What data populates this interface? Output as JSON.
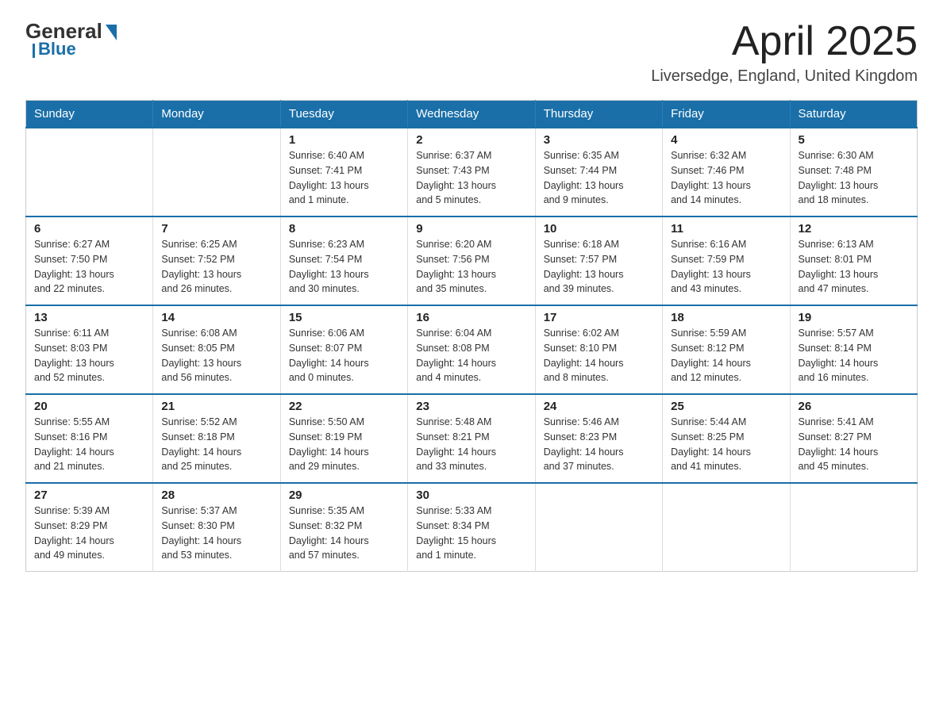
{
  "logo": {
    "general": "General",
    "blue": "Blue"
  },
  "title": "April 2025",
  "subtitle": "Liversedge, England, United Kingdom",
  "days_of_week": [
    "Sunday",
    "Monday",
    "Tuesday",
    "Wednesday",
    "Thursday",
    "Friday",
    "Saturday"
  ],
  "weeks": [
    [
      {
        "day": "",
        "detail": ""
      },
      {
        "day": "",
        "detail": ""
      },
      {
        "day": "1",
        "detail": "Sunrise: 6:40 AM\nSunset: 7:41 PM\nDaylight: 13 hours\nand 1 minute."
      },
      {
        "day": "2",
        "detail": "Sunrise: 6:37 AM\nSunset: 7:43 PM\nDaylight: 13 hours\nand 5 minutes."
      },
      {
        "day": "3",
        "detail": "Sunrise: 6:35 AM\nSunset: 7:44 PM\nDaylight: 13 hours\nand 9 minutes."
      },
      {
        "day": "4",
        "detail": "Sunrise: 6:32 AM\nSunset: 7:46 PM\nDaylight: 13 hours\nand 14 minutes."
      },
      {
        "day": "5",
        "detail": "Sunrise: 6:30 AM\nSunset: 7:48 PM\nDaylight: 13 hours\nand 18 minutes."
      }
    ],
    [
      {
        "day": "6",
        "detail": "Sunrise: 6:27 AM\nSunset: 7:50 PM\nDaylight: 13 hours\nand 22 minutes."
      },
      {
        "day": "7",
        "detail": "Sunrise: 6:25 AM\nSunset: 7:52 PM\nDaylight: 13 hours\nand 26 minutes."
      },
      {
        "day": "8",
        "detail": "Sunrise: 6:23 AM\nSunset: 7:54 PM\nDaylight: 13 hours\nand 30 minutes."
      },
      {
        "day": "9",
        "detail": "Sunrise: 6:20 AM\nSunset: 7:56 PM\nDaylight: 13 hours\nand 35 minutes."
      },
      {
        "day": "10",
        "detail": "Sunrise: 6:18 AM\nSunset: 7:57 PM\nDaylight: 13 hours\nand 39 minutes."
      },
      {
        "day": "11",
        "detail": "Sunrise: 6:16 AM\nSunset: 7:59 PM\nDaylight: 13 hours\nand 43 minutes."
      },
      {
        "day": "12",
        "detail": "Sunrise: 6:13 AM\nSunset: 8:01 PM\nDaylight: 13 hours\nand 47 minutes."
      }
    ],
    [
      {
        "day": "13",
        "detail": "Sunrise: 6:11 AM\nSunset: 8:03 PM\nDaylight: 13 hours\nand 52 minutes."
      },
      {
        "day": "14",
        "detail": "Sunrise: 6:08 AM\nSunset: 8:05 PM\nDaylight: 13 hours\nand 56 minutes."
      },
      {
        "day": "15",
        "detail": "Sunrise: 6:06 AM\nSunset: 8:07 PM\nDaylight: 14 hours\nand 0 minutes."
      },
      {
        "day": "16",
        "detail": "Sunrise: 6:04 AM\nSunset: 8:08 PM\nDaylight: 14 hours\nand 4 minutes."
      },
      {
        "day": "17",
        "detail": "Sunrise: 6:02 AM\nSunset: 8:10 PM\nDaylight: 14 hours\nand 8 minutes."
      },
      {
        "day": "18",
        "detail": "Sunrise: 5:59 AM\nSunset: 8:12 PM\nDaylight: 14 hours\nand 12 minutes."
      },
      {
        "day": "19",
        "detail": "Sunrise: 5:57 AM\nSunset: 8:14 PM\nDaylight: 14 hours\nand 16 minutes."
      }
    ],
    [
      {
        "day": "20",
        "detail": "Sunrise: 5:55 AM\nSunset: 8:16 PM\nDaylight: 14 hours\nand 21 minutes."
      },
      {
        "day": "21",
        "detail": "Sunrise: 5:52 AM\nSunset: 8:18 PM\nDaylight: 14 hours\nand 25 minutes."
      },
      {
        "day": "22",
        "detail": "Sunrise: 5:50 AM\nSunset: 8:19 PM\nDaylight: 14 hours\nand 29 minutes."
      },
      {
        "day": "23",
        "detail": "Sunrise: 5:48 AM\nSunset: 8:21 PM\nDaylight: 14 hours\nand 33 minutes."
      },
      {
        "day": "24",
        "detail": "Sunrise: 5:46 AM\nSunset: 8:23 PM\nDaylight: 14 hours\nand 37 minutes."
      },
      {
        "day": "25",
        "detail": "Sunrise: 5:44 AM\nSunset: 8:25 PM\nDaylight: 14 hours\nand 41 minutes."
      },
      {
        "day": "26",
        "detail": "Sunrise: 5:41 AM\nSunset: 8:27 PM\nDaylight: 14 hours\nand 45 minutes."
      }
    ],
    [
      {
        "day": "27",
        "detail": "Sunrise: 5:39 AM\nSunset: 8:29 PM\nDaylight: 14 hours\nand 49 minutes."
      },
      {
        "day": "28",
        "detail": "Sunrise: 5:37 AM\nSunset: 8:30 PM\nDaylight: 14 hours\nand 53 minutes."
      },
      {
        "day": "29",
        "detail": "Sunrise: 5:35 AM\nSunset: 8:32 PM\nDaylight: 14 hours\nand 57 minutes."
      },
      {
        "day": "30",
        "detail": "Sunrise: 5:33 AM\nSunset: 8:34 PM\nDaylight: 15 hours\nand 1 minute."
      },
      {
        "day": "",
        "detail": ""
      },
      {
        "day": "",
        "detail": ""
      },
      {
        "day": "",
        "detail": ""
      }
    ]
  ]
}
